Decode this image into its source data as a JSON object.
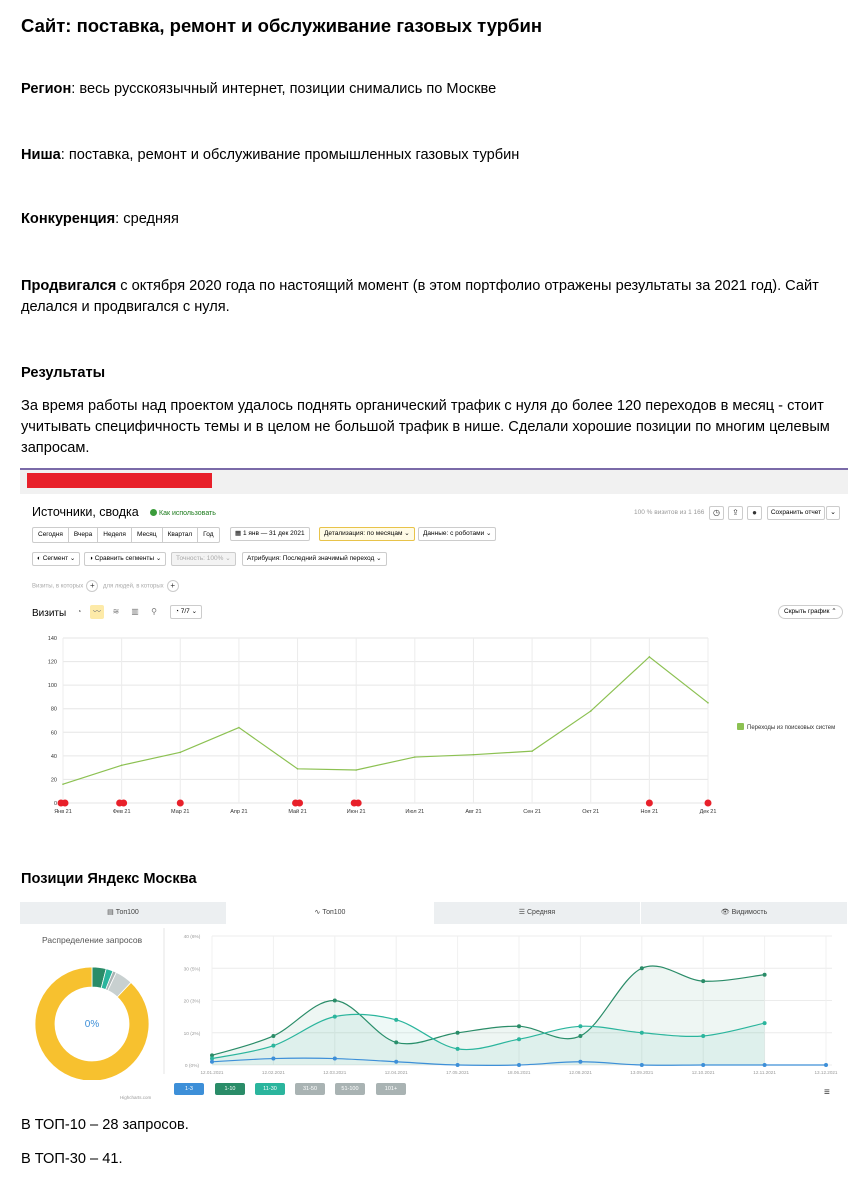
{
  "doc": {
    "title": "Сайт: поставка, ремонт и обслуживание газовых турбин",
    "region_label": "Регион",
    "region_text": ": весь русскоязычный интернет, позиции снимались по Москве",
    "niche_label": "Ниша",
    "niche_text": ": поставка, ремонт и обслуживание промышленных газовых турбин",
    "competition_label": "Конкуренция",
    "competition_text": ": средняя",
    "promo_label": "Продвигался",
    "promo_text_1": " с октября 2020 года по настоящий момент (в этом портфолио отражены результаты за 2021 год). Сайт",
    "promo_text_2": "делался и продвигался с нуля.",
    "results_heading": "Результаты",
    "results_line_1": "За время работы над проектом удалось поднять органический трафик с нуля до более 120 переходов в месяц - стоит",
    "results_line_2": "учитывать специфичность темы и в целом не большой трафик в нише. Сделали хорошие позиции по многим целевым",
    "results_line_3": "запросам.",
    "positions_heading": "Позиции Яндекс Москва",
    "top10": "В ТОП-10 – 28 запросов.",
    "top30": "В ТОП-30 – 41."
  },
  "metrica": {
    "report_title": "Источники, сводка",
    "how_to": "Как использовать",
    "visits_share": "100 % визитов из 1 166",
    "save_report": "Сохранить отчет",
    "period_tabs": [
      "Сегодня",
      "Вчера",
      "Неделя",
      "Месяц",
      "Квартал",
      "Год"
    ],
    "date_range": "1 янв — 31 дек 2021",
    "detail": "Детализация: по месяцам",
    "data": "Данные: с роботами",
    "segment": "Сегмент",
    "compare": "Сравнить сегменты",
    "accuracy": "Точность: 100%",
    "attribution": "Атрибуция: Последний значимый переход",
    "dim_line_1": "Визиты, в которых",
    "dim_line_2": "для людей, в которых",
    "visits_label": "Визиты",
    "series_count": "7/7",
    "hide_chart": "Скрыть график",
    "legend": "Переходы из поисковых систем",
    "colors": {
      "line": "#8cc152",
      "marker": "#e8202a"
    }
  },
  "positions": {
    "tabs": [
      "Топ100",
      "Топ100",
      "Средняя",
      "Видимость"
    ],
    "distribution_title": "Распределение запросов",
    "donut_center": "0%",
    "credits": "Highcharts.com",
    "buttons": [
      "1-3",
      "1-10",
      "11-30",
      "31-50",
      "51-100",
      "101+"
    ],
    "button_colors": [
      "#3d8fd8",
      "#2a8c68",
      "#2bb59d",
      "#a9b3b3",
      "#a9b3b3",
      "#a9b3b3"
    ]
  },
  "chart_data": [
    {
      "type": "line",
      "title": "",
      "categories": [
        "Янв 21",
        "Фев 21",
        "Мар 21",
        "Апр 21",
        "Май 21",
        "Июн 21",
        "Июл 21",
        "Авг 21",
        "Сен 21",
        "Окт 21",
        "Ноя 21",
        "Дек 21"
      ],
      "series": [
        {
          "name": "Переходы из поисковых систем",
          "values": [
            16,
            32,
            43,
            64,
            29,
            28,
            39,
            41,
            44,
            78,
            124,
            85
          ]
        }
      ],
      "yticks": [
        0,
        20,
        40,
        60,
        80,
        100,
        120,
        140
      ],
      "ylim": [
        0,
        140
      ],
      "grid": true,
      "legend": "right"
    },
    {
      "type": "area",
      "title": "",
      "categories": [
        "12.01.2021",
        "12.02.2021",
        "12.03.2021",
        "12.04.2021",
        "17.05.2021",
        "18.06.2021",
        "12.08.2021",
        "13.09.2021",
        "12.10.2021",
        "12.11.2021",
        "13.12.2021"
      ],
      "ytick_labels": [
        "0 (0%)",
        "10 (2%)",
        "20 (3%)",
        "30 (5%)",
        "40 (6%)"
      ],
      "ylim": [
        0,
        40
      ],
      "series": [
        {
          "name": "1-3",
          "values": [
            1,
            2,
            2,
            1,
            0,
            0,
            1,
            0,
            0,
            0,
            0
          ]
        },
        {
          "name": "1-10",
          "values": [
            3,
            9,
            20,
            7,
            10,
            12,
            9,
            30,
            26,
            28,
            null
          ]
        },
        {
          "name": "11-30",
          "values": [
            2,
            6,
            15,
            14,
            5,
            8,
            12,
            10,
            9,
            13,
            null
          ]
        }
      ],
      "grid": true
    },
    {
      "type": "pie",
      "title": "Распределение запросов",
      "labels": [
        "1-3",
        "1-10",
        "11-30",
        "31-50",
        "51-100",
        "101+"
      ],
      "values": [
        0,
        4,
        2,
        1,
        5,
        88
      ],
      "colors": [
        "#3d8fd8",
        "#2a8c68",
        "#2bb59d",
        "#a9b3b3",
        "#c8d0d0",
        "#f7c12f"
      ]
    }
  ]
}
